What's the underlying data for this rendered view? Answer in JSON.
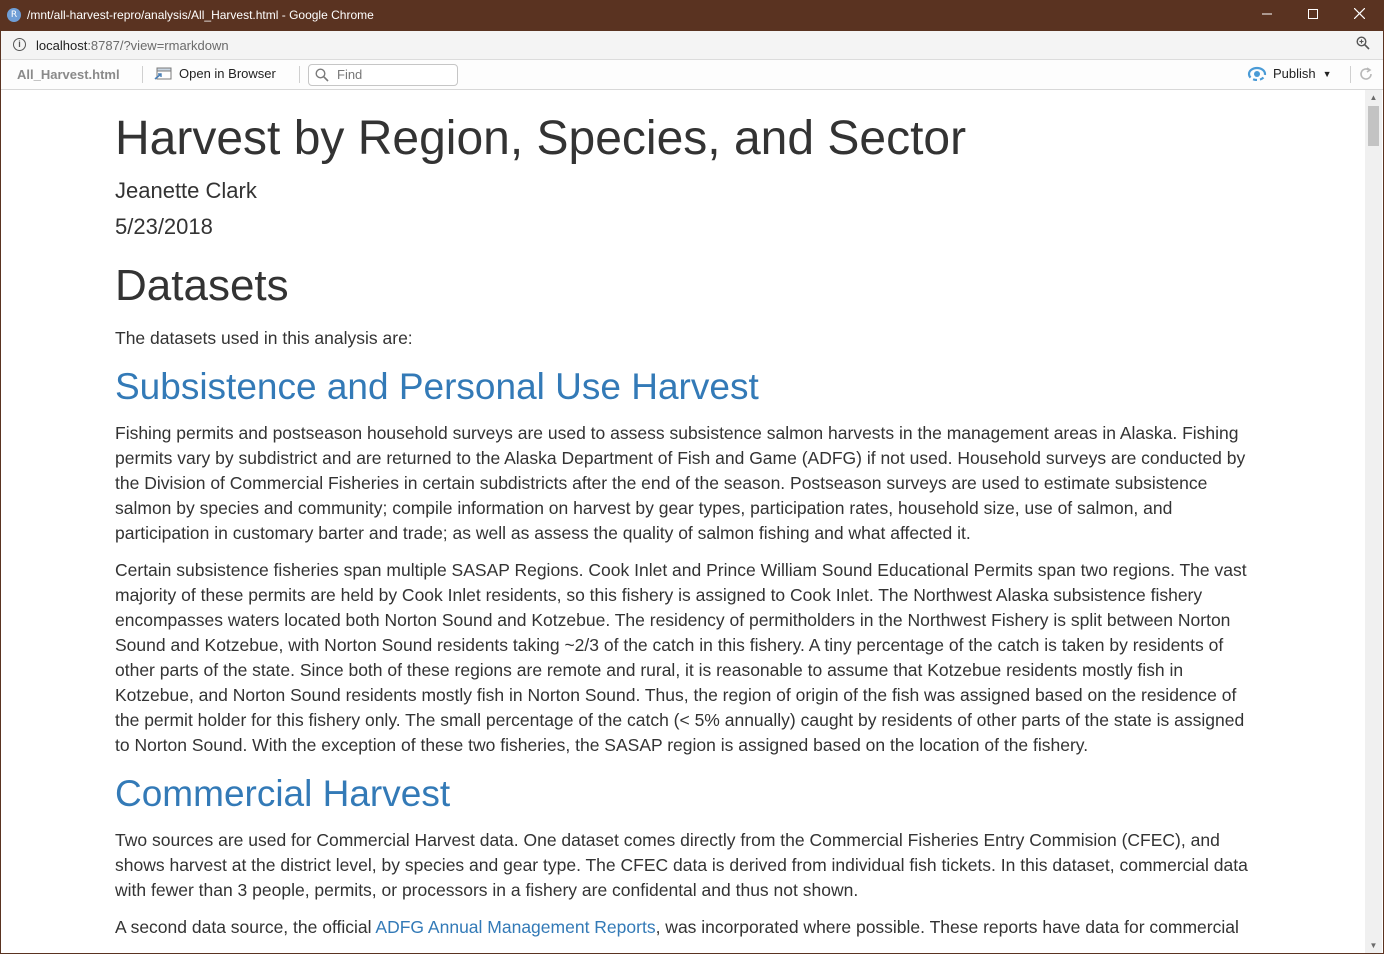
{
  "window": {
    "title": "/mnt/all-harvest-repro/analysis/All_Harvest.html - Google Chrome",
    "app_icon_letter": "R"
  },
  "address_bar": {
    "host": "localhost",
    "rest": ":8787/?view=rmarkdown"
  },
  "toolbar": {
    "filename": "All_Harvest.html",
    "open_in_browser": "Open in Browser",
    "find_placeholder": "Find",
    "publish": "Publish"
  },
  "document": {
    "title": "Harvest by Region, Species, and Sector",
    "author": "Jeanette Clark",
    "date": "5/23/2018",
    "datasets_heading": "Datasets",
    "datasets_intro": "The datasets used in this analysis are:",
    "subsistence_heading": "Subsistence and Personal Use Harvest",
    "subsistence_p1": "Fishing permits and postseason household surveys are used to assess subsistence salmon harvests in the management areas in Alaska. Fishing permits vary by subdistrict and are returned to the Alaska Department of Fish and Game (ADFG) if not used. Household surveys are conducted by the Division of Commercial Fisheries in certain subdistricts after the end of the season. Postseason surveys are used to estimate subsistence salmon by species and community; compile information on harvest by gear types, participation rates, household size, use of salmon, and participation in customary barter and trade; as well as assess the quality of salmon fishing and what affected it.",
    "subsistence_p2": "Certain subsistence fisheries span multiple SASAP Regions. Cook Inlet and Prince William Sound Educational Permits span two regions. The vast majority of these permits are held by Cook Inlet residents, so this fishery is assigned to Cook Inlet. The Northwest Alaska subsistence fishery encompasses waters located both Norton Sound and Kotzebue. The residency of permitholders in the Northwest Fishery is split between Norton Sound and Kotzebue, with Norton Sound residents taking ~2/3 of the catch in this fishery. A tiny percentage of the catch is taken by residents of other parts of the state. Since both of these regions are remote and rural, it is reasonable to assume that Kotzebue residents mostly fish in Kotzebue, and Norton Sound residents mostly fish in Norton Sound. Thus, the region of origin of the fish was assigned based on the residence of the permit holder for this fishery only. The small percentage of the catch (< 5% annually) caught by residents of other parts of the state is assigned to Norton Sound. With the exception of these two fisheries, the SASAP region is assigned based on the location of the fishery.",
    "commercial_heading": "Commercial Harvest",
    "commercial_p1": "Two sources are used for Commercial Harvest data. One dataset comes directly from the Commercial Fisheries Entry Commision (CFEC), and shows harvest at the district level, by species and gear type. The CFEC data is derived from individual fish tickets. In this dataset, commercial data with fewer than 3 people, permits, or processors in a fishery are confidental and thus not shown.",
    "commercial_p2_before": "A second data source, the official ",
    "commercial_p2_link": "ADFG Annual Management Reports",
    "commercial_p2_after": ", was incorporated where possible. These reports have data for commercial"
  }
}
